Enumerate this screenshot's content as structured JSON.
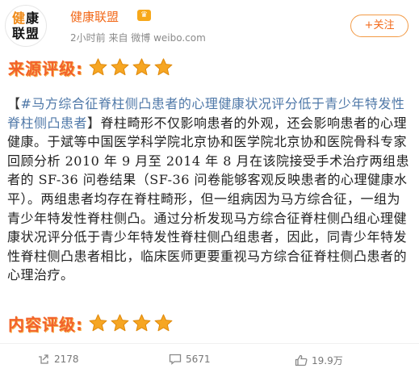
{
  "header": {
    "avatar_chars": [
      "健",
      "康",
      "联",
      "盟"
    ],
    "account_name": "健康联盟",
    "badge_icon": "vip-crown-icon",
    "meta": "2小时前  来自 微博 weibo.com",
    "follow_label": "+关注"
  },
  "source_rating": {
    "label": "来源评级:",
    "stars": 4
  },
  "post": {
    "bracket_open": "【",
    "hashtag": "#马方综合征脊柱侧凸患者的心理健康状况评分低于青少年特发性脊柱侧凸患者",
    "bracket_close": "】",
    "body": "脊柱畸形不仅影响患者的外观，还会影响患者的心理健康。于斌等中国医学科学院北京协和医学院北京协和医院骨科专家回顾分析 2010 年 9 月至 2014 年 8 月在该院接受手术治疗两组患者的 SF-36 问卷结果（SF-36 问卷能够客观反映患者的心理健康水平）。两组患者均存在脊柱畸形，但一组病因为马方综合征，一组为青少年特发性脊柱侧凸。通过分析发现马方综合征脊柱侧凸组心理健康状况评分低于青少年特发性脊柱侧凸组患者，因此，同青少年特发性脊柱侧凸患者相比，临床医师更要重视马方综合征脊柱侧凸患者的心理治疗。"
  },
  "content_rating": {
    "label": "内容评级:",
    "stars": 4
  },
  "footer": {
    "share_count": "2178",
    "comment_count": "5671",
    "like_count": "19.9万"
  },
  "colors": {
    "accent": "#f26a1b",
    "hashtag": "#4f78a8",
    "star": "#f6a623"
  }
}
